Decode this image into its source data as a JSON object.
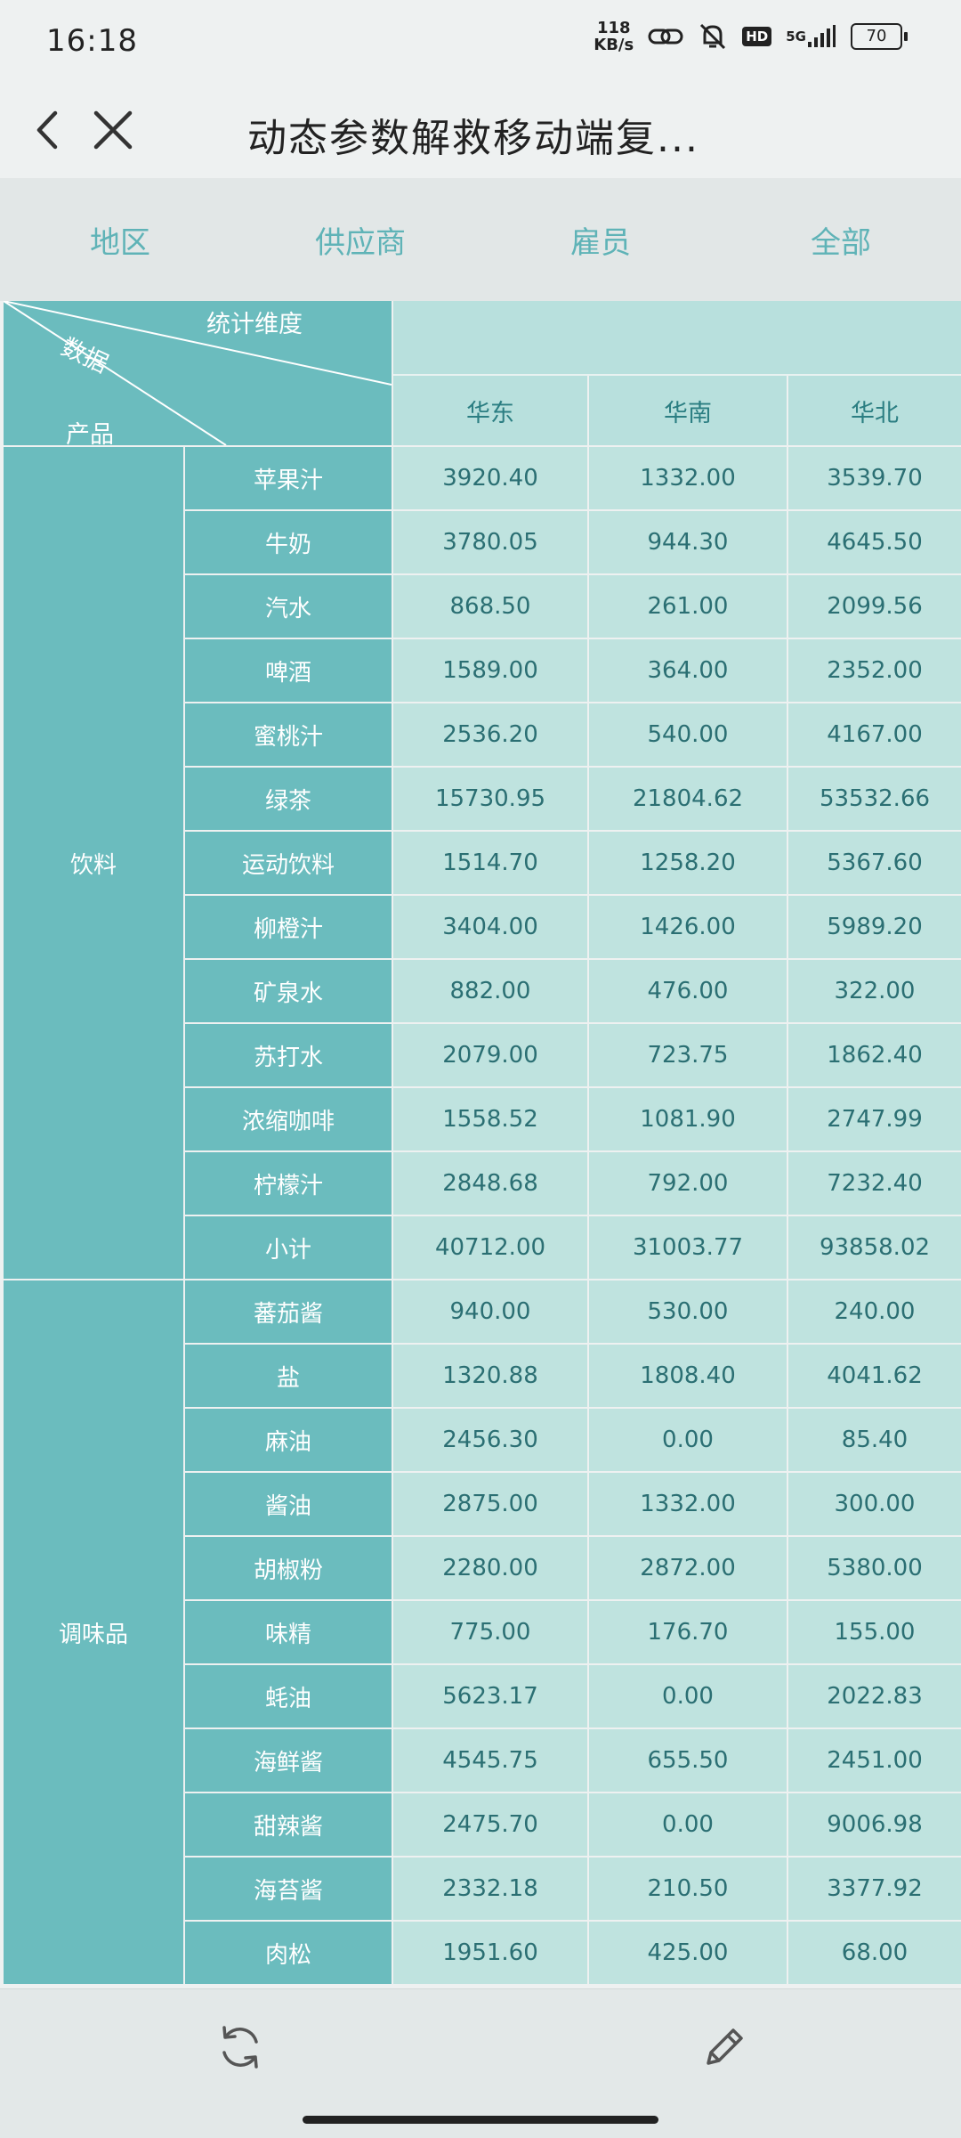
{
  "status": {
    "time": "16:18",
    "net_speed_value": "118",
    "net_speed_unit": "KB/s",
    "hd": "HD",
    "network": "5G",
    "battery": "70"
  },
  "title_bar": {
    "title": "动态参数解救移动端复..."
  },
  "tabs": [
    {
      "label": "地区"
    },
    {
      "label": "供应商"
    },
    {
      "label": "雇员"
    },
    {
      "label": "全部"
    }
  ],
  "table": {
    "corner": {
      "dimension": "统计维度",
      "data": "数据",
      "product": "产品"
    },
    "columns": [
      "华东",
      "华南",
      "华北"
    ],
    "groups": [
      {
        "category": "饮料",
        "rows": [
          {
            "product": "苹果汁",
            "values": [
              "3920.40",
              "1332.00",
              "3539.70"
            ]
          },
          {
            "product": "牛奶",
            "values": [
              "3780.05",
              "944.30",
              "4645.50"
            ]
          },
          {
            "product": "汽水",
            "values": [
              "868.50",
              "261.00",
              "2099.56"
            ]
          },
          {
            "product": "啤酒",
            "values": [
              "1589.00",
              "364.00",
              "2352.00"
            ]
          },
          {
            "product": "蜜桃汁",
            "values": [
              "2536.20",
              "540.00",
              "4167.00"
            ]
          },
          {
            "product": "绿茶",
            "values": [
              "15730.95",
              "21804.62",
              "53532.66"
            ]
          },
          {
            "product": "运动饮料",
            "values": [
              "1514.70",
              "1258.20",
              "5367.60"
            ]
          },
          {
            "product": "柳橙汁",
            "values": [
              "3404.00",
              "1426.00",
              "5989.20"
            ]
          },
          {
            "product": "矿泉水",
            "values": [
              "882.00",
              "476.00",
              "322.00"
            ]
          },
          {
            "product": "苏打水",
            "values": [
              "2079.00",
              "723.75",
              "1862.40"
            ]
          },
          {
            "product": "浓缩咖啡",
            "values": [
              "1558.52",
              "1081.90",
              "2747.99"
            ]
          },
          {
            "product": "柠檬汁",
            "values": [
              "2848.68",
              "792.00",
              "7232.40"
            ]
          },
          {
            "product": "小计",
            "values": [
              "40712.00",
              "31003.77",
              "93858.02"
            ]
          }
        ]
      },
      {
        "category": "调味品",
        "rows": [
          {
            "product": "蕃茄酱",
            "values": [
              "940.00",
              "530.00",
              "240.00"
            ]
          },
          {
            "product": "盐",
            "values": [
              "1320.88",
              "1808.40",
              "4041.62"
            ]
          },
          {
            "product": "麻油",
            "values": [
              "2456.30",
              "0.00",
              "85.40"
            ]
          },
          {
            "product": "酱油",
            "values": [
              "2875.00",
              "1332.00",
              "300.00"
            ]
          },
          {
            "product": "胡椒粉",
            "values": [
              "2280.00",
              "2872.00",
              "5380.00"
            ]
          },
          {
            "product": "味精",
            "values": [
              "775.00",
              "176.70",
              "155.00"
            ]
          },
          {
            "product": "蚝油",
            "values": [
              "5623.17",
              "0.00",
              "2022.83"
            ]
          },
          {
            "product": "海鲜酱",
            "values": [
              "4545.75",
              "655.50",
              "2451.00"
            ]
          },
          {
            "product": "甜辣酱",
            "values": [
              "2475.70",
              "0.00",
              "9006.98"
            ]
          },
          {
            "product": "海苔酱",
            "values": [
              "2332.18",
              "210.50",
              "3377.92"
            ]
          },
          {
            "product": "肉松",
            "values": [
              "1951.60",
              "425.00",
              "68.00"
            ]
          }
        ]
      }
    ]
  },
  "colors": {
    "header_teal": "#6bbcbe",
    "cell_light": "#bfe3df",
    "tab_text": "#5fb3b7"
  }
}
